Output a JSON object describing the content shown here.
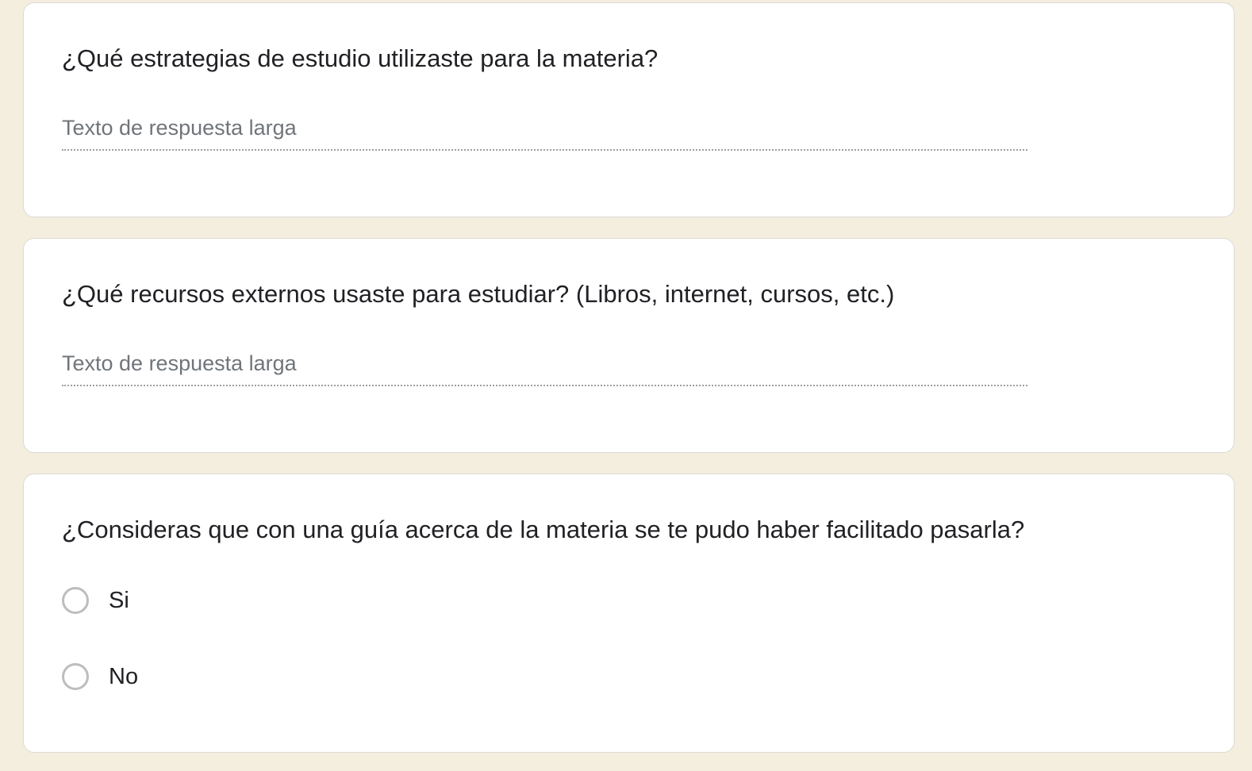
{
  "questions": [
    {
      "title": "¿Qué estrategias de estudio utilizaste para la materia?",
      "type": "long-answer",
      "placeholder": "Texto de respuesta larga"
    },
    {
      "title": "¿Qué recursos externos usaste para estudiar? (Libros, internet, cursos, etc.)",
      "type": "long-answer",
      "placeholder": "Texto de respuesta larga"
    },
    {
      "title": "¿Consideras que con una guía acerca de la materia se te pudo haber facilitado pasarla?",
      "type": "multiple-choice",
      "options": [
        {
          "label": "Si",
          "selected": false
        },
        {
          "label": "No",
          "selected": false
        }
      ]
    }
  ],
  "colors": {
    "background": "#f4eedf",
    "card": "#ffffff",
    "text": "#202124",
    "placeholder": "#70757a",
    "radio_border": "#bdbdbd"
  }
}
